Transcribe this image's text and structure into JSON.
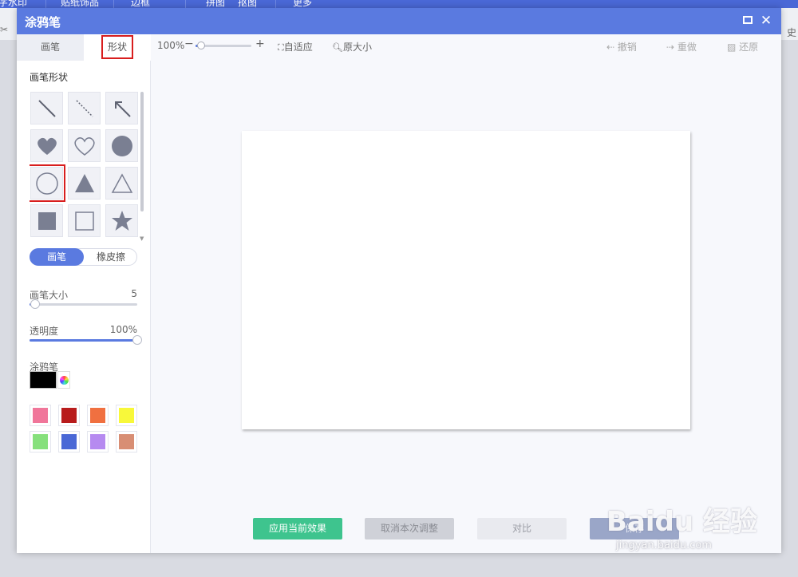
{
  "background": {
    "menu_items": [
      "字水印",
      "贴纸饰品",
      "边框",
      "拼图",
      "抠图",
      "更多"
    ],
    "right_text": "史"
  },
  "dialog": {
    "title": "涂鸦笔",
    "maximize_label": "",
    "close_label": "✕"
  },
  "left_panel": {
    "tabs": {
      "pen": "画笔",
      "shape": "形状"
    },
    "shape_section_label": "画笔形状",
    "shapes": [
      "line",
      "dashed-line",
      "arrow",
      "heart-filled",
      "heart-outline",
      "circle-filled",
      "circle-outline",
      "triangle-filled",
      "triangle-outline",
      "square-filled",
      "square-outline",
      "star-filled"
    ],
    "mode": {
      "pen": "画笔",
      "eraser": "橡皮擦",
      "active": "pen"
    },
    "brush_size": {
      "label": "画笔大小",
      "value": "5",
      "fraction": 0.05
    },
    "opacity": {
      "label": "透明度",
      "value": "100%",
      "fraction": 1.0
    },
    "color_section_label": "涂鸦笔",
    "current_color": "#000000",
    "swatches": [
      "#f0769a",
      "#b81c1c",
      "#f07040",
      "#f8f83a",
      "#86e07c",
      "#4a68d6",
      "#b68af0",
      "#d88e74"
    ]
  },
  "toolbar": {
    "zoom_label": "100%",
    "zoom_minus": "−",
    "zoom_plus": "+",
    "zoom_fraction": 0.1,
    "fit_label": "自适应",
    "original_label": "原大小",
    "undo_label": "撤销",
    "redo_label": "重做",
    "restore_label": "还原"
  },
  "actions": {
    "apply": "应用当前效果",
    "cancel": "取消本次调整",
    "compare": "对比",
    "save": "保存"
  },
  "watermark": {
    "logo": "Baidu 经验",
    "url": "jingyan.baidu.com"
  },
  "colors": {
    "titlebar": "#5a7ae0",
    "accent": "#5a7ae0",
    "apply": "#3ec48e",
    "highlight": "#d81e1e"
  }
}
